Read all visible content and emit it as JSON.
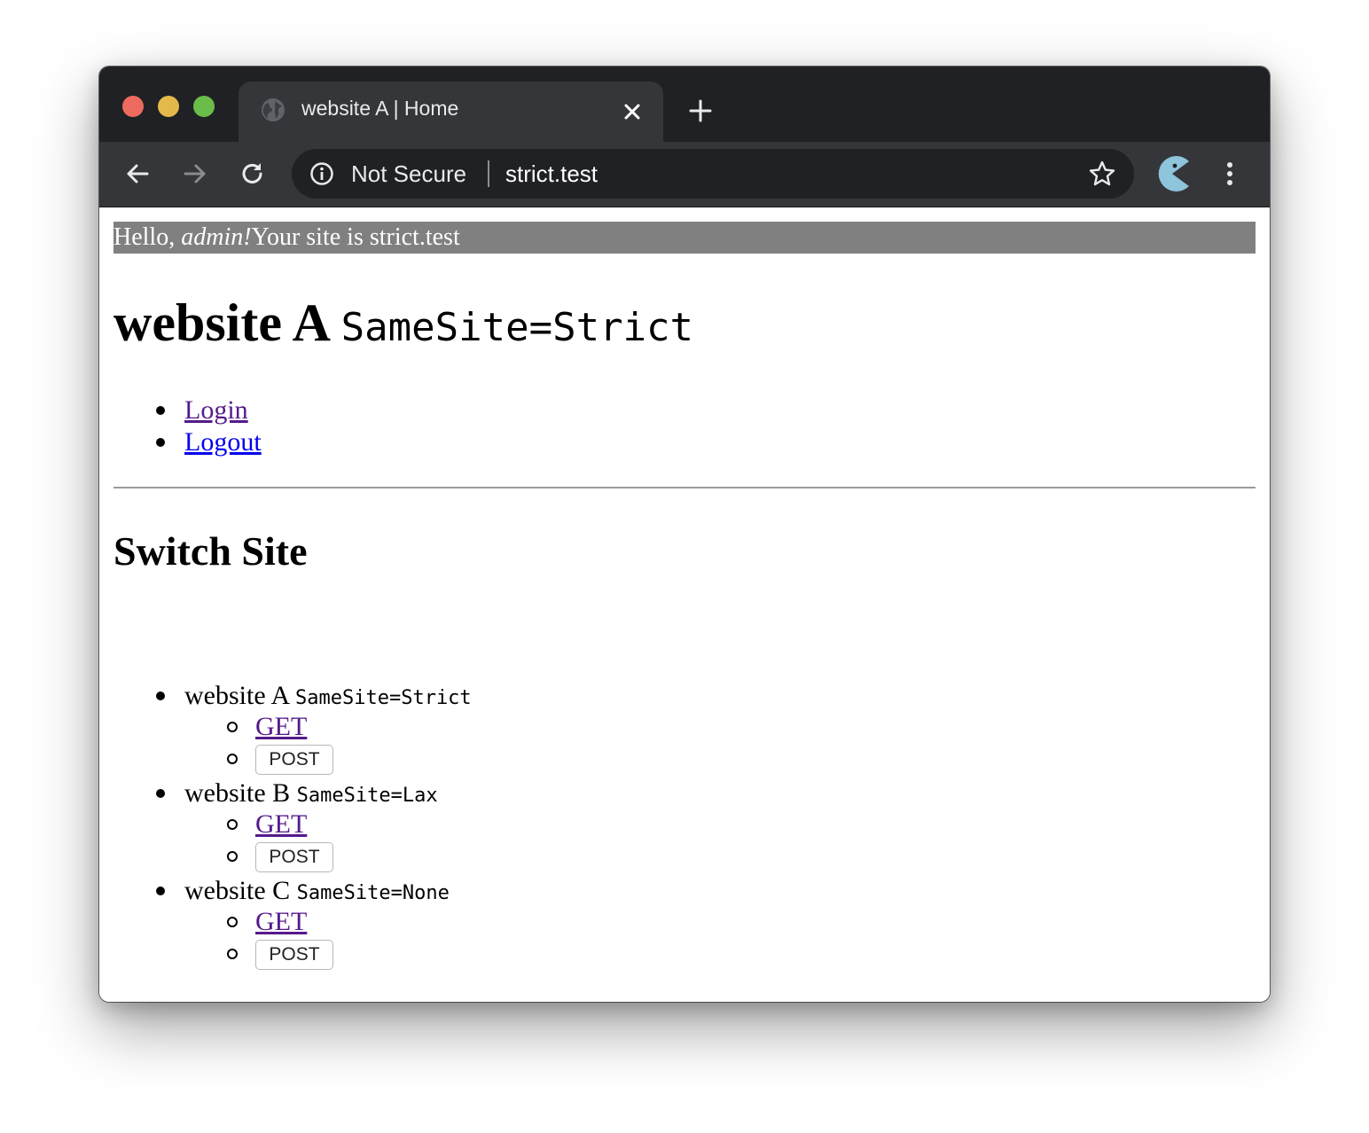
{
  "browser": {
    "tab_title": "website A | Home",
    "security_label": "Not Secure",
    "url": "strict.test"
  },
  "page": {
    "greeting_prefix": "Hello, ",
    "greeting_user": "admin!",
    "greeting_suffix": "Your site is strict.test",
    "title": "website A",
    "title_code": "SameSite=Strict",
    "nav": {
      "login": "Login",
      "logout": "Logout"
    },
    "switch_heading": "Switch Site",
    "sites": [
      {
        "name": "website A",
        "samesite": "SameSite=Strict",
        "get_label": "GET",
        "post_label": "POST"
      },
      {
        "name": "website B",
        "samesite": "SameSite=Lax",
        "get_label": "GET",
        "post_label": "POST"
      },
      {
        "name": "website C",
        "samesite": "SameSite=None",
        "get_label": "GET",
        "post_label": "POST"
      }
    ]
  },
  "colors": {
    "titlebar": "#202124",
    "toolbar": "#35363a",
    "visited_link": "#551a8b",
    "unvisited_link": "#0000ee",
    "greeting_bg": "#808080",
    "close_button": "#ed6a5e",
    "minimize_button": "#e4b94b",
    "maximize_button": "#6bbd4a"
  }
}
